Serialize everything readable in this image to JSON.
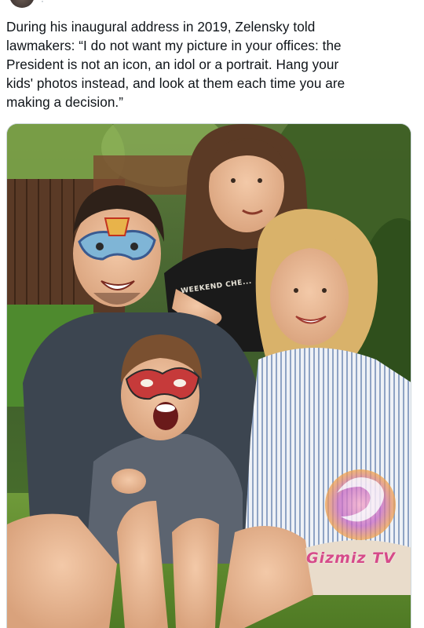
{
  "tweet": {
    "text": "During his inaugural address in 2019, Zelensky told\nlawmakers: “I do not want my picture in your offices: the\nPresident is not an icon, an idol or a portrait. Hang your\nkids' photos instead, and look at them each time you are\nmaking a decision.”"
  },
  "media": {
    "watermark": "Gizmiz TV",
    "shirt_print": "WEEKEND CHE..."
  },
  "colors": {
    "text": "#0f1419",
    "watermark": "#d64b8a",
    "border": "#cfd9de"
  }
}
